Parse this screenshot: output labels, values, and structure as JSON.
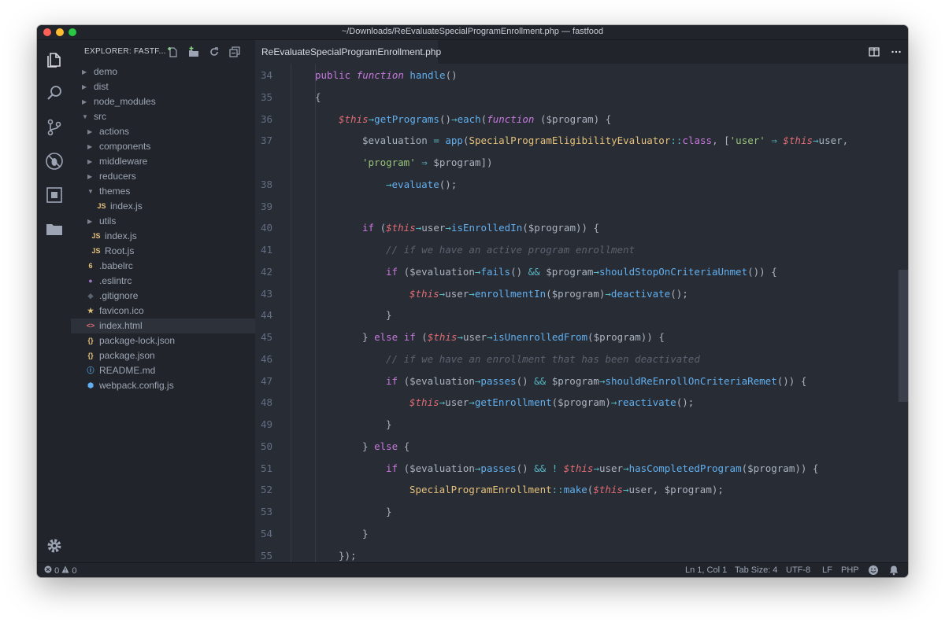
{
  "window": {
    "title": "~/Downloads/ReEvaluateSpecialProgramEnrollment.php — fastfood"
  },
  "activity_bar": {
    "icons": [
      "files-icon",
      "search-icon",
      "source-control-icon",
      "debug-icon",
      "extensions-icon",
      "folder-icon",
      "gear-icon"
    ]
  },
  "explorer": {
    "title": "EXPLORER: FASTF...",
    "actions": [
      "new-file-icon",
      "new-folder-icon",
      "refresh-icon",
      "collapse-all-icon"
    ],
    "items": [
      {
        "name": "demo",
        "kind": "folder",
        "open": false
      },
      {
        "name": "dist",
        "kind": "folder",
        "open": false
      },
      {
        "name": "node_modules",
        "kind": "folder",
        "open": false
      },
      {
        "name": "src",
        "kind": "folder",
        "open": true
      },
      {
        "name": "actions",
        "kind": "folder",
        "open": false
      },
      {
        "name": "components",
        "kind": "folder",
        "open": false
      },
      {
        "name": "middleware",
        "kind": "folder",
        "open": false
      },
      {
        "name": "reducers",
        "kind": "folder",
        "open": false
      },
      {
        "name": "themes",
        "kind": "folder",
        "open": true
      },
      {
        "name": "index.js",
        "kind": "js"
      },
      {
        "name": "utils",
        "kind": "folder",
        "open": false
      },
      {
        "name": "index.js",
        "kind": "js"
      },
      {
        "name": "Root.js",
        "kind": "js"
      },
      {
        "name": ".babelrc",
        "kind": "babel"
      },
      {
        "name": ".eslintrc",
        "kind": "eslint"
      },
      {
        "name": ".gitignore",
        "kind": "git"
      },
      {
        "name": "favicon.ico",
        "kind": "star"
      },
      {
        "name": "index.html",
        "kind": "html",
        "selected": true
      },
      {
        "name": "package-lock.json",
        "kind": "json"
      },
      {
        "name": "package.json",
        "kind": "json"
      },
      {
        "name": "README.md",
        "kind": "info"
      },
      {
        "name": "webpack.config.js",
        "kind": "webpack"
      }
    ]
  },
  "editor": {
    "tab": "ReEvaluateSpecialProgramEnrollment.php",
    "tab_actions": [
      "split-editor-icon",
      "more-icon"
    ],
    "lines": [
      {
        "n": "34",
        "indent": 1,
        "tokens": [
          [
            "k",
            "public "
          ],
          [
            "kf",
            "function "
          ],
          [
            "f",
            "handle"
          ],
          [
            "v",
            "()"
          ]
        ]
      },
      {
        "n": "35",
        "indent": 1,
        "tokens": [
          [
            "v",
            "{"
          ]
        ]
      },
      {
        "n": "36",
        "indent": 2,
        "tokens": [
          [
            "tv",
            "$this"
          ],
          [
            "op",
            "→"
          ],
          [
            "f",
            "getPrograms"
          ],
          [
            "v",
            "()"
          ],
          [
            "op",
            "→"
          ],
          [
            "f",
            "each"
          ],
          [
            "v",
            "("
          ],
          [
            "kf",
            "function "
          ],
          [
            "v",
            "($program) {"
          ]
        ]
      },
      {
        "n": "37",
        "indent": 3,
        "tokens": [
          [
            "v",
            "$evaluation "
          ],
          [
            "op",
            "= "
          ],
          [
            "f",
            "app"
          ],
          [
            "v",
            "("
          ],
          [
            "cl",
            "SpecialProgramEligibilityEvaluator"
          ],
          [
            "op",
            "::"
          ],
          [
            "k",
            "class"
          ],
          [
            "v",
            ", ["
          ],
          [
            "s",
            "'user'"
          ],
          [
            "op",
            " ⇒ "
          ],
          [
            "tv",
            "$this"
          ],
          [
            "op",
            "→"
          ],
          [
            "v",
            "user,"
          ]
        ]
      },
      {
        "n": "",
        "indent": 3,
        "tokens": [
          [
            "s",
            "'program'"
          ],
          [
            "op",
            " ⇒ "
          ],
          [
            "v",
            "$program])"
          ]
        ]
      },
      {
        "n": "38",
        "indent": 4,
        "tokens": [
          [
            "op",
            "→"
          ],
          [
            "f",
            "evaluate"
          ],
          [
            "v",
            "();"
          ]
        ]
      },
      {
        "n": "39",
        "indent": 0,
        "tokens": []
      },
      {
        "n": "40",
        "indent": 3,
        "tokens": [
          [
            "k",
            "if "
          ],
          [
            "v",
            "("
          ],
          [
            "tv",
            "$this"
          ],
          [
            "op",
            "→"
          ],
          [
            "v",
            "user"
          ],
          [
            "op",
            "→"
          ],
          [
            "f",
            "isEnrolledIn"
          ],
          [
            "v",
            "($program)) {"
          ]
        ]
      },
      {
        "n": "41",
        "indent": 4,
        "tokens": [
          [
            "c",
            "// if we have an active program enrollment"
          ]
        ]
      },
      {
        "n": "42",
        "indent": 4,
        "tokens": [
          [
            "k",
            "if "
          ],
          [
            "v",
            "($evaluation"
          ],
          [
            "op",
            "→"
          ],
          [
            "f",
            "fails"
          ],
          [
            "v",
            "() "
          ],
          [
            "op",
            "&& "
          ],
          [
            "v",
            "$program"
          ],
          [
            "op",
            "→"
          ],
          [
            "f",
            "shouldStopOnCriteriaUnmet"
          ],
          [
            "v",
            "()) {"
          ]
        ]
      },
      {
        "n": "43",
        "indent": 5,
        "tokens": [
          [
            "tv",
            "$this"
          ],
          [
            "op",
            "→"
          ],
          [
            "v",
            "user"
          ],
          [
            "op",
            "→"
          ],
          [
            "f",
            "enrollmentIn"
          ],
          [
            "v",
            "($program)"
          ],
          [
            "op",
            "→"
          ],
          [
            "f",
            "deactivate"
          ],
          [
            "v",
            "();"
          ]
        ]
      },
      {
        "n": "44",
        "indent": 4,
        "tokens": [
          [
            "v",
            "}"
          ]
        ]
      },
      {
        "n": "45",
        "indent": 3,
        "tokens": [
          [
            "v",
            "} "
          ],
          [
            "k",
            "else if "
          ],
          [
            "v",
            "("
          ],
          [
            "tv",
            "$this"
          ],
          [
            "op",
            "→"
          ],
          [
            "v",
            "user"
          ],
          [
            "op",
            "→"
          ],
          [
            "f",
            "isUnenrolledFrom"
          ],
          [
            "v",
            "($program)) {"
          ]
        ]
      },
      {
        "n": "46",
        "indent": 4,
        "tokens": [
          [
            "c",
            "// if we have an enrollment that has been deactivated"
          ]
        ]
      },
      {
        "n": "47",
        "indent": 4,
        "tokens": [
          [
            "k",
            "if "
          ],
          [
            "v",
            "($evaluation"
          ],
          [
            "op",
            "→"
          ],
          [
            "f",
            "passes"
          ],
          [
            "v",
            "() "
          ],
          [
            "op",
            "&& "
          ],
          [
            "v",
            "$program"
          ],
          [
            "op",
            "→"
          ],
          [
            "f",
            "shouldReEnrollOnCriteriaRemet"
          ],
          [
            "v",
            "()) {"
          ]
        ]
      },
      {
        "n": "48",
        "indent": 5,
        "tokens": [
          [
            "tv",
            "$this"
          ],
          [
            "op",
            "→"
          ],
          [
            "v",
            "user"
          ],
          [
            "op",
            "→"
          ],
          [
            "f",
            "getEnrollment"
          ],
          [
            "v",
            "($program)"
          ],
          [
            "op",
            "→"
          ],
          [
            "f",
            "reactivate"
          ],
          [
            "v",
            "();"
          ]
        ]
      },
      {
        "n": "49",
        "indent": 4,
        "tokens": [
          [
            "v",
            "}"
          ]
        ]
      },
      {
        "n": "50",
        "indent": 3,
        "tokens": [
          [
            "v",
            "} "
          ],
          [
            "k",
            "else "
          ],
          [
            "v",
            "{"
          ]
        ]
      },
      {
        "n": "51",
        "indent": 4,
        "tokens": [
          [
            "k",
            "if "
          ],
          [
            "v",
            "($evaluation"
          ],
          [
            "op",
            "→"
          ],
          [
            "f",
            "passes"
          ],
          [
            "v",
            "() "
          ],
          [
            "op",
            "&& ! "
          ],
          [
            "tv",
            "$this"
          ],
          [
            "op",
            "→"
          ],
          [
            "v",
            "user"
          ],
          [
            "op",
            "→"
          ],
          [
            "f",
            "hasCompletedProgram"
          ],
          [
            "v",
            "($program)) {"
          ]
        ]
      },
      {
        "n": "52",
        "indent": 5,
        "tokens": [
          [
            "cl",
            "SpecialProgramEnrollment"
          ],
          [
            "op",
            "::"
          ],
          [
            "f",
            "make"
          ],
          [
            "v",
            "("
          ],
          [
            "tv",
            "$this"
          ],
          [
            "op",
            "→"
          ],
          [
            "v",
            "user, $program);"
          ]
        ]
      },
      {
        "n": "53",
        "indent": 4,
        "tokens": [
          [
            "v",
            "}"
          ]
        ]
      },
      {
        "n": "54",
        "indent": 3,
        "tokens": [
          [
            "v",
            "}"
          ]
        ]
      },
      {
        "n": "55",
        "indent": 2,
        "tokens": [
          [
            "v",
            "});"
          ]
        ]
      }
    ]
  },
  "status": {
    "errors": "0",
    "warnings": "0",
    "position": "Ln 1, Col 1",
    "tab_size": "Tab Size: 4",
    "encoding": "UTF-8",
    "eol": "LF",
    "language": "PHP"
  },
  "colors": {
    "background": "#282c34",
    "sidebar": "#21252b",
    "keyword": "#c678dd",
    "function": "#61afef",
    "string": "#98c379",
    "variable_this": "#e06c75",
    "comment": "#5c6370"
  }
}
